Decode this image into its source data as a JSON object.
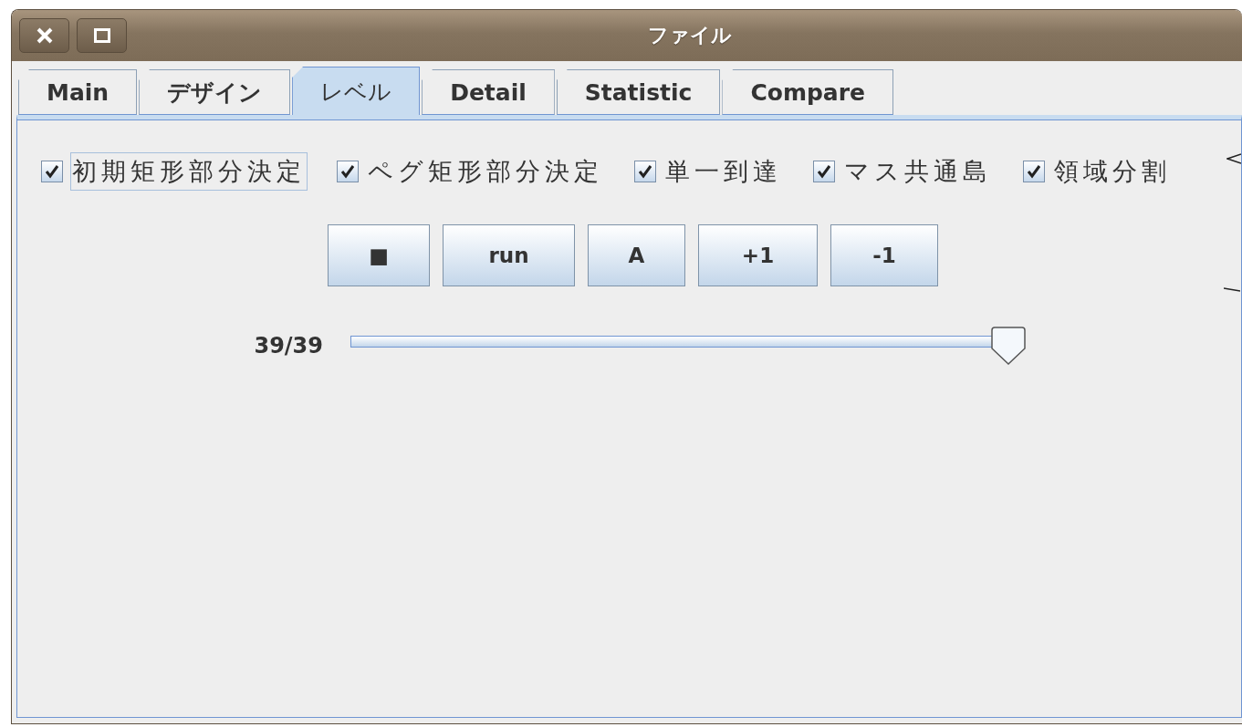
{
  "window": {
    "title": "ファイル"
  },
  "tabs": [
    {
      "label": "Main",
      "selected": false
    },
    {
      "label": "デザイン",
      "selected": false
    },
    {
      "label": "レベル",
      "selected": true
    },
    {
      "label": "Detail",
      "selected": false
    },
    {
      "label": "Statistic",
      "selected": false
    },
    {
      "label": "Compare",
      "selected": false
    }
  ],
  "checkboxes": [
    {
      "label": "初期矩形部分決定",
      "checked": true,
      "focused": true
    },
    {
      "label": "ペグ矩形部分決定",
      "checked": true,
      "focused": false
    },
    {
      "label": "単一到達",
      "checked": true,
      "focused": false
    },
    {
      "label": "マス共通島",
      "checked": true,
      "focused": false
    },
    {
      "label": "領域分割",
      "checked": true,
      "focused": false
    }
  ],
  "buttons": [
    {
      "label": "■"
    },
    {
      "label": "run"
    },
    {
      "label": "A"
    },
    {
      "label": "+1"
    },
    {
      "label": "-1"
    }
  ],
  "slider": {
    "reading": "39/39",
    "level": 1
  }
}
